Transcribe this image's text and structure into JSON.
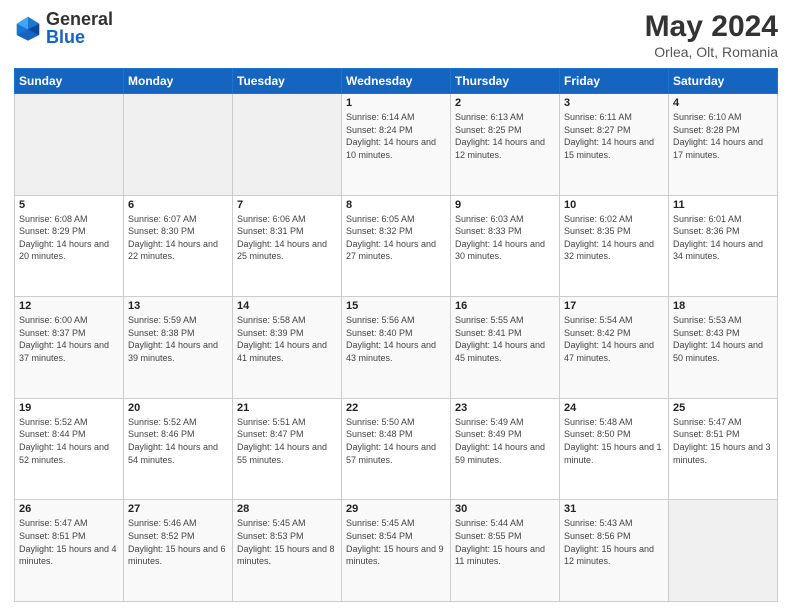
{
  "header": {
    "logo_general": "General",
    "logo_blue": "Blue",
    "month_year": "May 2024",
    "location": "Orlea, Olt, Romania"
  },
  "days_of_week": [
    "Sunday",
    "Monday",
    "Tuesday",
    "Wednesday",
    "Thursday",
    "Friday",
    "Saturday"
  ],
  "weeks": [
    [
      {
        "day": "",
        "sunrise": "",
        "sunset": "",
        "daylight": ""
      },
      {
        "day": "",
        "sunrise": "",
        "sunset": "",
        "daylight": ""
      },
      {
        "day": "",
        "sunrise": "",
        "sunset": "",
        "daylight": ""
      },
      {
        "day": "1",
        "sunrise": "Sunrise: 6:14 AM",
        "sunset": "Sunset: 8:24 PM",
        "daylight": "Daylight: 14 hours and 10 minutes."
      },
      {
        "day": "2",
        "sunrise": "Sunrise: 6:13 AM",
        "sunset": "Sunset: 8:25 PM",
        "daylight": "Daylight: 14 hours and 12 minutes."
      },
      {
        "day": "3",
        "sunrise": "Sunrise: 6:11 AM",
        "sunset": "Sunset: 8:27 PM",
        "daylight": "Daylight: 14 hours and 15 minutes."
      },
      {
        "day": "4",
        "sunrise": "Sunrise: 6:10 AM",
        "sunset": "Sunset: 8:28 PM",
        "daylight": "Daylight: 14 hours and 17 minutes."
      }
    ],
    [
      {
        "day": "5",
        "sunrise": "Sunrise: 6:08 AM",
        "sunset": "Sunset: 8:29 PM",
        "daylight": "Daylight: 14 hours and 20 minutes."
      },
      {
        "day": "6",
        "sunrise": "Sunrise: 6:07 AM",
        "sunset": "Sunset: 8:30 PM",
        "daylight": "Daylight: 14 hours and 22 minutes."
      },
      {
        "day": "7",
        "sunrise": "Sunrise: 6:06 AM",
        "sunset": "Sunset: 8:31 PM",
        "daylight": "Daylight: 14 hours and 25 minutes."
      },
      {
        "day": "8",
        "sunrise": "Sunrise: 6:05 AM",
        "sunset": "Sunset: 8:32 PM",
        "daylight": "Daylight: 14 hours and 27 minutes."
      },
      {
        "day": "9",
        "sunrise": "Sunrise: 6:03 AM",
        "sunset": "Sunset: 8:33 PM",
        "daylight": "Daylight: 14 hours and 30 minutes."
      },
      {
        "day": "10",
        "sunrise": "Sunrise: 6:02 AM",
        "sunset": "Sunset: 8:35 PM",
        "daylight": "Daylight: 14 hours and 32 minutes."
      },
      {
        "day": "11",
        "sunrise": "Sunrise: 6:01 AM",
        "sunset": "Sunset: 8:36 PM",
        "daylight": "Daylight: 14 hours and 34 minutes."
      }
    ],
    [
      {
        "day": "12",
        "sunrise": "Sunrise: 6:00 AM",
        "sunset": "Sunset: 8:37 PM",
        "daylight": "Daylight: 14 hours and 37 minutes."
      },
      {
        "day": "13",
        "sunrise": "Sunrise: 5:59 AM",
        "sunset": "Sunset: 8:38 PM",
        "daylight": "Daylight: 14 hours and 39 minutes."
      },
      {
        "day": "14",
        "sunrise": "Sunrise: 5:58 AM",
        "sunset": "Sunset: 8:39 PM",
        "daylight": "Daylight: 14 hours and 41 minutes."
      },
      {
        "day": "15",
        "sunrise": "Sunrise: 5:56 AM",
        "sunset": "Sunset: 8:40 PM",
        "daylight": "Daylight: 14 hours and 43 minutes."
      },
      {
        "day": "16",
        "sunrise": "Sunrise: 5:55 AM",
        "sunset": "Sunset: 8:41 PM",
        "daylight": "Daylight: 14 hours and 45 minutes."
      },
      {
        "day": "17",
        "sunrise": "Sunrise: 5:54 AM",
        "sunset": "Sunset: 8:42 PM",
        "daylight": "Daylight: 14 hours and 47 minutes."
      },
      {
        "day": "18",
        "sunrise": "Sunrise: 5:53 AM",
        "sunset": "Sunset: 8:43 PM",
        "daylight": "Daylight: 14 hours and 50 minutes."
      }
    ],
    [
      {
        "day": "19",
        "sunrise": "Sunrise: 5:52 AM",
        "sunset": "Sunset: 8:44 PM",
        "daylight": "Daylight: 14 hours and 52 minutes."
      },
      {
        "day": "20",
        "sunrise": "Sunrise: 5:52 AM",
        "sunset": "Sunset: 8:46 PM",
        "daylight": "Daylight: 14 hours and 54 minutes."
      },
      {
        "day": "21",
        "sunrise": "Sunrise: 5:51 AM",
        "sunset": "Sunset: 8:47 PM",
        "daylight": "Daylight: 14 hours and 55 minutes."
      },
      {
        "day": "22",
        "sunrise": "Sunrise: 5:50 AM",
        "sunset": "Sunset: 8:48 PM",
        "daylight": "Daylight: 14 hours and 57 minutes."
      },
      {
        "day": "23",
        "sunrise": "Sunrise: 5:49 AM",
        "sunset": "Sunset: 8:49 PM",
        "daylight": "Daylight: 14 hours and 59 minutes."
      },
      {
        "day": "24",
        "sunrise": "Sunrise: 5:48 AM",
        "sunset": "Sunset: 8:50 PM",
        "daylight": "Daylight: 15 hours and 1 minute."
      },
      {
        "day": "25",
        "sunrise": "Sunrise: 5:47 AM",
        "sunset": "Sunset: 8:51 PM",
        "daylight": "Daylight: 15 hours and 3 minutes."
      }
    ],
    [
      {
        "day": "26",
        "sunrise": "Sunrise: 5:47 AM",
        "sunset": "Sunset: 8:51 PM",
        "daylight": "Daylight: 15 hours and 4 minutes."
      },
      {
        "day": "27",
        "sunrise": "Sunrise: 5:46 AM",
        "sunset": "Sunset: 8:52 PM",
        "daylight": "Daylight: 15 hours and 6 minutes."
      },
      {
        "day": "28",
        "sunrise": "Sunrise: 5:45 AM",
        "sunset": "Sunset: 8:53 PM",
        "daylight": "Daylight: 15 hours and 8 minutes."
      },
      {
        "day": "29",
        "sunrise": "Sunrise: 5:45 AM",
        "sunset": "Sunset: 8:54 PM",
        "daylight": "Daylight: 15 hours and 9 minutes."
      },
      {
        "day": "30",
        "sunrise": "Sunrise: 5:44 AM",
        "sunset": "Sunset: 8:55 PM",
        "daylight": "Daylight: 15 hours and 11 minutes."
      },
      {
        "day": "31",
        "sunrise": "Sunrise: 5:43 AM",
        "sunset": "Sunset: 8:56 PM",
        "daylight": "Daylight: 15 hours and 12 minutes."
      },
      {
        "day": "",
        "sunrise": "",
        "sunset": "",
        "daylight": ""
      }
    ]
  ]
}
